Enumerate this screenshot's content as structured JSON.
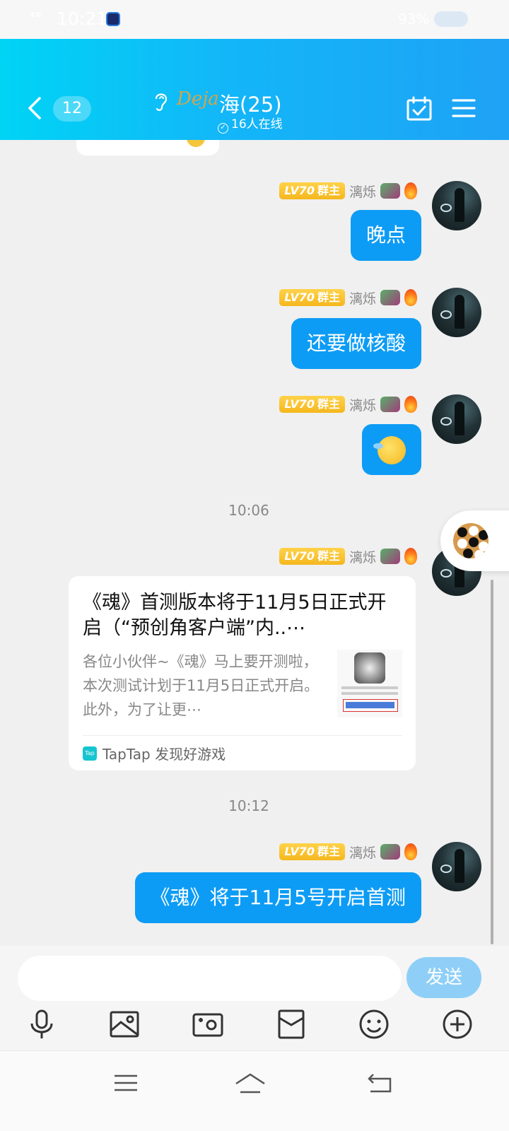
{
  "status_bar": {
    "signal": "4G",
    "time": "10:21",
    "battery_percent": "93%"
  },
  "header": {
    "unread_count": "12",
    "decor_text": "Deja",
    "title": "海(25)",
    "online_text": "16人在线"
  },
  "messages": [
    {
      "level": "LV70",
      "role": "群主",
      "nickname": "漓烁",
      "text": "晚点"
    },
    {
      "level": "LV70",
      "role": "群主",
      "nickname": "漓烁",
      "text": "还要做核酸"
    },
    {
      "level": "LV70",
      "role": "群主",
      "nickname": "漓烁",
      "text": "",
      "emoji": "crying-laughing-emoji"
    },
    {
      "level": "LV70",
      "role": "群主",
      "nickname": "漓烁"
    },
    {
      "level": "LV70",
      "role": "群主",
      "nickname": "漓烁",
      "text": "《魂》将于11月5号开启首测"
    }
  ],
  "timestamps": [
    "10:06",
    "10:12"
  ],
  "shared_card": {
    "title": "《魂》首测版本将于11月5日正式开启（“预创角客户端”内..⋯",
    "description": "各位小伙伴~《魂》马上要开测啦，本次测试计划于11月5日正式开启。此外，为了让更⋯",
    "source": "TapTap 发现好游戏",
    "source_icon_text": "Tap"
  },
  "input": {
    "placeholder": "",
    "send_label": "发送"
  },
  "toolbar_icons": [
    "microphone-icon",
    "image-icon",
    "camera-icon",
    "red-packet-icon",
    "emoji-icon",
    "plus-icon"
  ],
  "navbar_icons": [
    "menu-icon",
    "home-icon",
    "back-icon"
  ],
  "colors": {
    "header_gradient_start": "#00d4f5",
    "header_gradient_end": "#1ea2f5",
    "bubble_blue": "#0d9cf5",
    "send_button": "#8fcff7",
    "level_badge": "#f5b71e"
  }
}
